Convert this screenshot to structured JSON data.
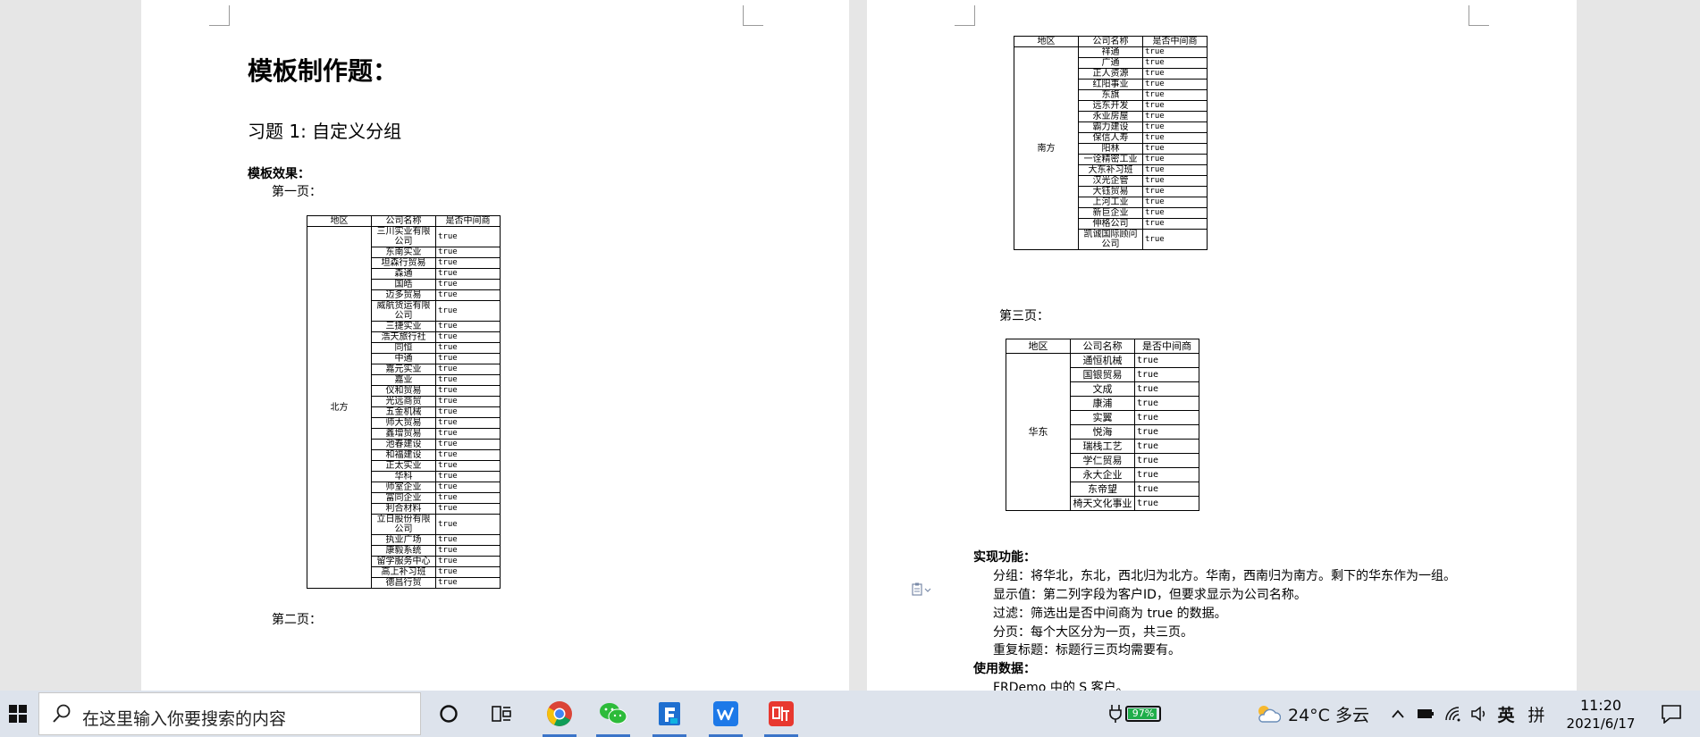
{
  "doc": {
    "title": "模板制作题：",
    "exercise": "习题 1:  自定义分组",
    "effect_label": "模板效果：",
    "page1_label": "第一页：",
    "page2_label": "第二页：",
    "page3_label": "第三页：",
    "features_label": "实现功能：",
    "features": [
      "分组：将华北，东北，西北归为北方。华南，西南归为南方。剩下的华东作为一组。",
      "显示值：第二列字段为客户ID，但要求显示为公司名称。",
      "过滤：筛选出是否中间商为 true 的数据。",
      "分页：每个大区分为一页，共三页。",
      "重复标题：标题行三页均需要有。"
    ],
    "usage_label": "使用数据：",
    "usage_prefix": "FRDemo",
    "usage_rest": " 中的 S 客户。"
  },
  "table_headers": {
    "region": "地区",
    "company": "公司名称",
    "intermediary": "是否中间商"
  },
  "table_p1": {
    "region": "北方",
    "rows": [
      {
        "name": "三川实业有限公司",
        "val": "true"
      },
      {
        "name": "东南实业",
        "val": "true"
      },
      {
        "name": "坦森行贸易",
        "val": "true"
      },
      {
        "name": "森通",
        "val": "true"
      },
      {
        "name": "国皓",
        "val": "true"
      },
      {
        "name": "迈多贸易",
        "val": "true"
      },
      {
        "name": "威航货运有限公司",
        "val": "true"
      },
      {
        "name": "三捷实业",
        "val": "true"
      },
      {
        "name": "浩天旅行社",
        "val": "true"
      },
      {
        "name": "同恒",
        "val": "true"
      },
      {
        "name": "中通",
        "val": "true"
      },
      {
        "name": "嘉元实业",
        "val": "true"
      },
      {
        "name": "嘉业",
        "val": "true"
      },
      {
        "name": "仪和贸易",
        "val": "true"
      },
      {
        "name": "光远商贸",
        "val": "true"
      },
      {
        "name": "五金机械",
        "val": "true"
      },
      {
        "name": "师大贸易",
        "val": "true"
      },
      {
        "name": "鑫增贸易",
        "val": "true"
      },
      {
        "name": "池春建设",
        "val": "true"
      },
      {
        "name": "和福建设",
        "val": "true"
      },
      {
        "name": "正太实业",
        "val": "true"
      },
      {
        "name": "华科",
        "val": "true"
      },
      {
        "name": "师室企业",
        "val": "true"
      },
      {
        "name": "富同企业",
        "val": "true"
      },
      {
        "name": "利合材料",
        "val": "true"
      },
      {
        "name": "立日股份有限公司",
        "val": "true"
      },
      {
        "name": "执业广场",
        "val": "true"
      },
      {
        "name": "康毅系统",
        "val": "true"
      },
      {
        "name": "留学服务中心",
        "val": "true"
      },
      {
        "name": "高上补习班",
        "val": "true"
      },
      {
        "name": "德昌行贸",
        "val": "true"
      }
    ]
  },
  "table_p2": {
    "region": "南方",
    "rows": [
      {
        "name": "祥通",
        "val": "true"
      },
      {
        "name": "广通",
        "val": "true"
      },
      {
        "name": "正人资源",
        "val": "true"
      },
      {
        "name": "红阳事业",
        "val": "true"
      },
      {
        "name": "东旗",
        "val": "true"
      },
      {
        "name": "远东开发",
        "val": "true"
      },
      {
        "name": "永业房屋",
        "val": "true"
      },
      {
        "name": "霸力建设",
        "val": "true"
      },
      {
        "name": "保信人寿",
        "val": "true"
      },
      {
        "name": "阳林",
        "val": "true"
      },
      {
        "name": "一诠精密工业",
        "val": "true"
      },
      {
        "name": "大东补习班",
        "val": "true"
      },
      {
        "name": "汉光企管",
        "val": "true"
      },
      {
        "name": "大钰贸易",
        "val": "true"
      },
      {
        "name": "上河工业",
        "val": "true"
      },
      {
        "name": "新巨企业",
        "val": "true"
      },
      {
        "name": "伸格公司",
        "val": "true"
      },
      {
        "name": "凯诚国际顾问公司",
        "val": "true"
      }
    ]
  },
  "table_p3": {
    "region": "华东",
    "rows": [
      {
        "name": "通恒机械",
        "val": "true"
      },
      {
        "name": "国银贸易",
        "val": "true"
      },
      {
        "name": "文成",
        "val": "true"
      },
      {
        "name": "康浦",
        "val": "true"
      },
      {
        "name": "实翼",
        "val": "true"
      },
      {
        "name": "悦海",
        "val": "true"
      },
      {
        "name": "瑞栈工艺",
        "val": "true"
      },
      {
        "name": "学仁贸易",
        "val": "true"
      },
      {
        "name": "永大企业",
        "val": "true"
      },
      {
        "name": "东帝望",
        "val": "true"
      },
      {
        "name": "椅天文化事业",
        "val": "true"
      }
    ]
  },
  "taskbar": {
    "search_placeholder": "在这里输入你要搜索的内容",
    "battery": "97%",
    "weather": "24°C  多云",
    "ime_lang": "英",
    "ime_mode": "拼",
    "time": "11:20",
    "date": "2021/6/17",
    "accent_color": "#3a74c8"
  }
}
